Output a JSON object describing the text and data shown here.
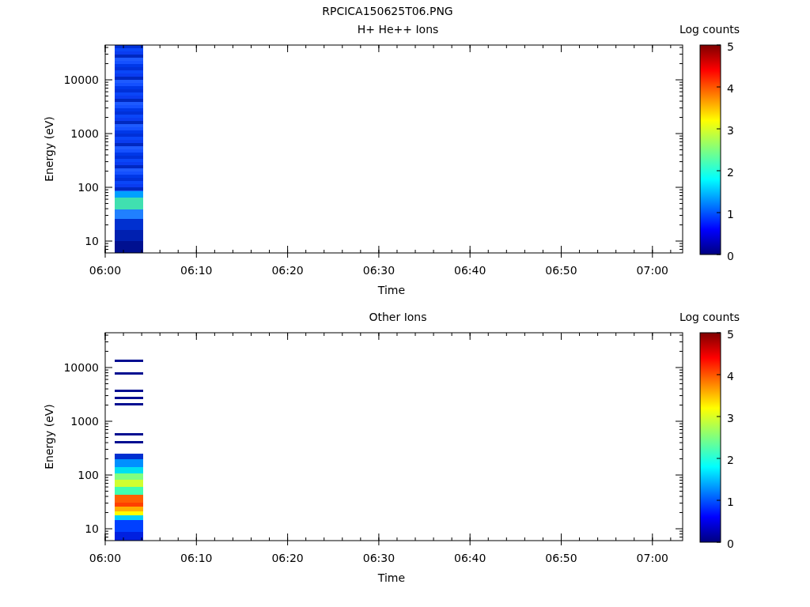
{
  "title": "RPCICA150625T06.PNG",
  "panels": [
    {
      "kind": "protons",
      "title": "H+ He++ Ions",
      "ylabel": "Energy (eV)",
      "xlabel": "Time",
      "yticks": [
        "10000",
        "1000",
        "100",
        "10"
      ],
      "xticks": [
        "06:00",
        "06:10",
        "06:20",
        "06:30",
        "06:40",
        "06:50",
        "07:00"
      ],
      "colorbar": {
        "label": "Log counts",
        "ticks": [
          "5",
          "4",
          "3",
          "2",
          "1",
          "0"
        ]
      }
    },
    {
      "kind": "other",
      "title": "Other Ions",
      "ylabel": "Energy (eV)",
      "xlabel": "Time",
      "yticks": [
        "10000",
        "1000",
        "100",
        "10"
      ],
      "xticks": [
        "06:00",
        "06:10",
        "06:20",
        "06:30",
        "06:40",
        "06:50",
        "07:00"
      ],
      "colorbar": {
        "label": "Log counts",
        "ticks": [
          "5",
          "4",
          "3",
          "2",
          "1",
          "0"
        ]
      }
    }
  ]
}
